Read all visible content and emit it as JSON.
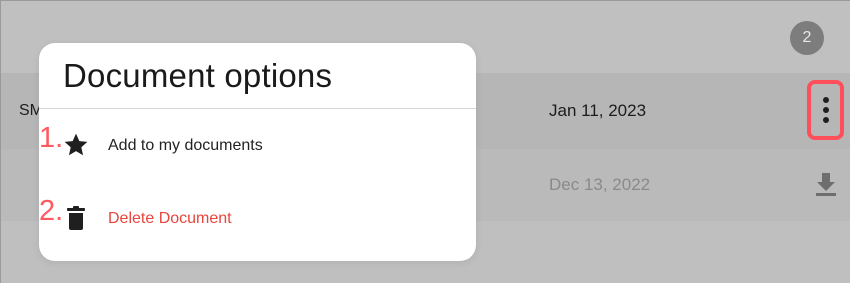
{
  "background_list": {
    "count_badge": "2",
    "rows": [
      {
        "name_prefix": "SM",
        "date": "Jan 11, 2023"
      },
      {
        "name_prefix": "",
        "date": "Dec 13, 2022"
      }
    ]
  },
  "popup": {
    "title": "Document options",
    "options": [
      {
        "step": "1.",
        "label": "Add to my documents",
        "icon": "star-icon"
      },
      {
        "step": "2.",
        "label": "Delete Document",
        "icon": "trash-icon"
      }
    ]
  },
  "colors": {
    "highlight": "#ff4f5a",
    "delete_text": "#e8453c",
    "overlay_bg": "#b8b8b8"
  },
  "icons": {
    "row_1_action": "more-vertical-icon",
    "row_2_action": "download-icon"
  }
}
